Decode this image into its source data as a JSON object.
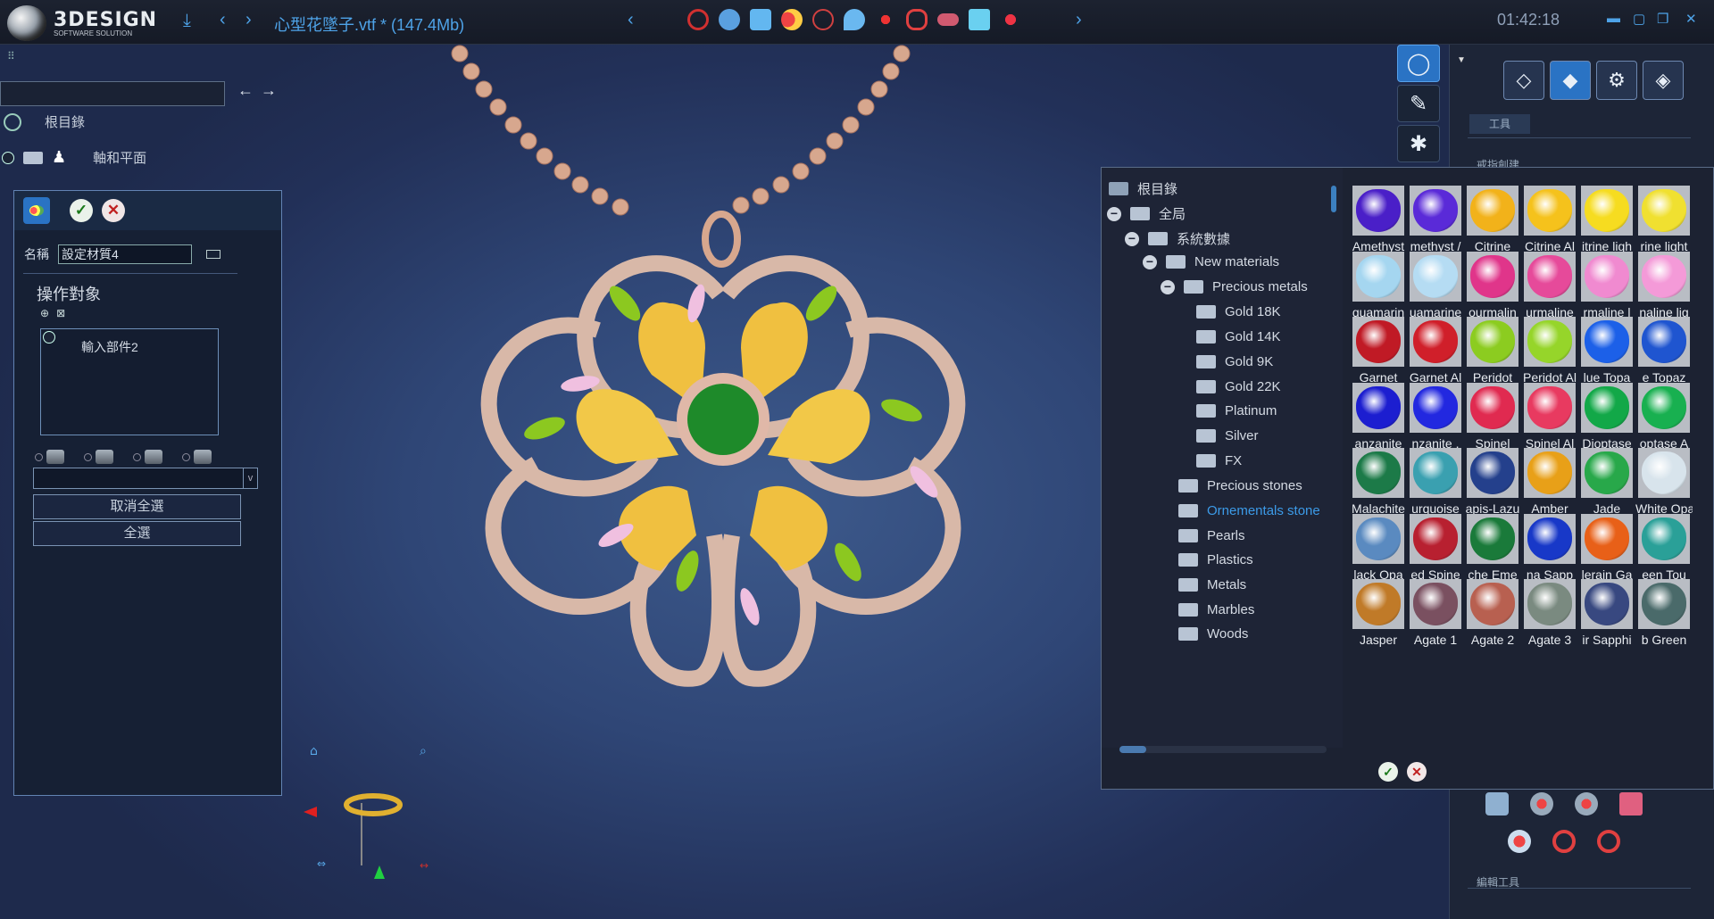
{
  "app": {
    "brand": "3DESIGN",
    "brand_sub": "SOFTWARE SOLUTION",
    "file_title": "心型花墜子.vtf *",
    "file_size": "(147.4Mb)",
    "clock": "01:42:18",
    "accent": "#4ea3e8"
  },
  "left_tree": {
    "root_label": "根目錄",
    "axes_label": "軸和平面"
  },
  "panel": {
    "name_label": "名稱",
    "name_value": "設定材質4",
    "section_title": "操作對象",
    "object_item": "輸入部件2",
    "deselect_all": "取消全選",
    "select_all": "全選"
  },
  "dock": {
    "tab_label": "工具",
    "caption_create": "戒指創建",
    "caption_edit": "編輯工具"
  },
  "material_tree": {
    "root": "根目錄",
    "global": "全局",
    "system_data": "系統數據",
    "new_materials": "New materials",
    "precious_metals": "Precious metals",
    "metals": [
      "Gold 18K",
      "Gold 14K",
      "Gold 9K",
      "Gold 22K",
      "Platinum",
      "Silver",
      "FX"
    ],
    "categories": [
      "Precious stones",
      "Ornementals stone",
      "Pearls",
      "Plastics",
      "Metals",
      "Marbles",
      "Woods"
    ]
  },
  "swatches": [
    {
      "label": "Amethyst",
      "color": "#4a1fc8"
    },
    {
      "label": "Amethyst A",
      "color": "#5a2ad8"
    },
    {
      "label": "Citrine",
      "color": "#f2b21a"
    },
    {
      "label": "Citrine Al",
      "color": "#f5c21c"
    },
    {
      "label": "Citrine light",
      "color": "#f6dc20"
    },
    {
      "label": "Citrine light A",
      "color": "#f0e030"
    },
    {
      "label": "Aquamarine",
      "color": "#a5d6f0"
    },
    {
      "label": "Aquamarine A",
      "color": "#b5dcf3"
    },
    {
      "label": "Tourmaline",
      "color": "#e0358a"
    },
    {
      "label": "Tourmaline A",
      "color": "#e64a9a"
    },
    {
      "label": "Tourmaline light",
      "color": "#f08ad0"
    },
    {
      "label": "Tourmaline light A",
      "color": "#f49ad8"
    },
    {
      "label": "Garnet",
      "color": "#c01a25"
    },
    {
      "label": "Garnet Al",
      "color": "#d01f2a"
    },
    {
      "label": "Peridot",
      "color": "#8ccc20"
    },
    {
      "label": "Peridot Al",
      "color": "#96d52a"
    },
    {
      "label": "Blue Topaz",
      "color": "#1c60e8"
    },
    {
      "label": "Blue Topaz A",
      "color": "#1f55d0"
    },
    {
      "label": "Tanzanite",
      "color": "#1c1ed0"
    },
    {
      "label": "Tanzanite A",
      "color": "#2228e0"
    },
    {
      "label": "Spinel",
      "color": "#e02a50"
    },
    {
      "label": "Spinel Al",
      "color": "#e83a60"
    },
    {
      "label": "Dioptase",
      "color": "#12a848"
    },
    {
      "label": "Dioptase A",
      "color": "#18b050"
    },
    {
      "label": "Malachite",
      "color": "#1c7a48"
    },
    {
      "label": "Turquoise",
      "color": "#3aa0b0"
    },
    {
      "label": "Lapis-Lazuli",
      "color": "#24408c"
    },
    {
      "label": "Amber",
      "color": "#e8a018"
    },
    {
      "label": "Jade",
      "color": "#28a84a"
    },
    {
      "label": "White Opal",
      "color": "#d8e4ec"
    },
    {
      "label": "Black Opal",
      "color": "#5a8ac0"
    },
    {
      "label": "Red Spinel",
      "color": "#b82030"
    },
    {
      "label": "Trapiche Emerald",
      "color": "#1a7a3a"
    },
    {
      "label": "Blue Sapphire",
      "color": "#1838c8"
    },
    {
      "label": "Mandarin Garnet",
      "color": "#e86018"
    },
    {
      "label": "Green Tourmaline",
      "color": "#2aa098"
    },
    {
      "label": "Jasper",
      "color": "#c07a28"
    },
    {
      "label": "Agate 1",
      "color": "#7a5060"
    },
    {
      "label": "Agate 2",
      "color": "#b86050"
    },
    {
      "label": "Agate 3",
      "color": "#7a8a80"
    },
    {
      "label": "Star Sapphire",
      "color": "#384880"
    },
    {
      "label": "Tahitian Green",
      "color": "#4a6a6a"
    }
  ],
  "swatch_visible_labels": [
    "Amethyst",
    "methyst /",
    "Citrine",
    "Citrine Al",
    "itrine ligh",
    "rine light",
    "quamarin",
    "uamarine",
    "ourmalin",
    "urmaline",
    "rmaline l",
    "naline lig",
    "Garnet",
    "Garnet Al",
    "Peridot",
    "Peridot Al",
    "lue Topa",
    "e Topaz",
    "anzanite",
    "nzanite .",
    "Spinel",
    "Spinel Al",
    "Dioptase",
    "optase A",
    "Malachite",
    "urquoise",
    "apis-Lazu",
    "Amber",
    "Jade",
    "White Opa",
    "lack Opa",
    "ed Spine",
    "che Eme",
    "na Sapp",
    "lerain Ga",
    "een Tou",
    "Jasper",
    "Agate 1",
    "Agate 2",
    "Agate 3",
    "ir Sapphi",
    "b Green"
  ]
}
